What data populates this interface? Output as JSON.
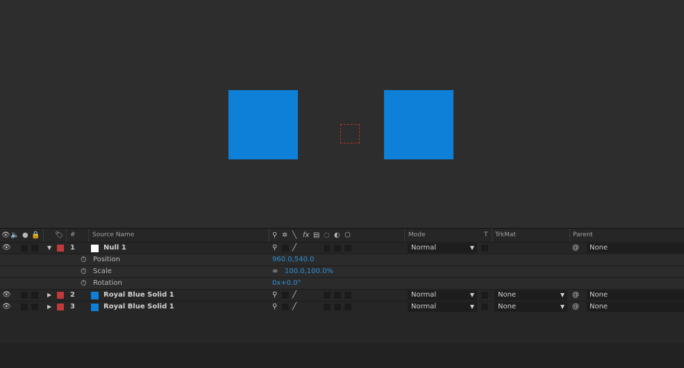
{
  "colors": {
    "solid_blue": "#0e80d8",
    "label_red": "#c0393b",
    "null_white": "#ffffff",
    "value_blue": "#2f8fd5"
  },
  "header": {
    "av_icons": [
      "eye-icon",
      "speaker-icon",
      "solo-icon",
      "lock-icon"
    ],
    "label_icon": "tag-icon",
    "num": "#",
    "source_name": "Source Name",
    "switch_icons": [
      "shy-icon",
      "collapse-icon",
      "quality-icon",
      "fx-icon",
      "frame-blend-icon",
      "motion-blur-icon",
      "adjustment-icon",
      "3d-icon"
    ],
    "mode": "Mode",
    "t": "T",
    "trkmat": "TrkMat",
    "parent": "Parent"
  },
  "layers": [
    {
      "num": "1",
      "name": "Null 1",
      "twirl": "▼",
      "color": "#ffffff",
      "mode": "Normal",
      "trkmat": "",
      "parent": "None",
      "properties": [
        {
          "name": "Position",
          "value": "960.0,540.0"
        },
        {
          "name": "Scale",
          "value": "100.0,100.0%"
        },
        {
          "name": "Rotation",
          "value": "0x+0.0°"
        }
      ]
    },
    {
      "num": "2",
      "name": "Royal Blue Solid 1",
      "twirl": "▶",
      "color": "#0e80d8",
      "mode": "Normal",
      "trkmat": "None",
      "parent": "None"
    },
    {
      "num": "3",
      "name": "Royal Blue Solid 1",
      "twirl": "▶",
      "color": "#0e80d8",
      "mode": "Normal",
      "trkmat": "None",
      "parent": "None"
    }
  ]
}
